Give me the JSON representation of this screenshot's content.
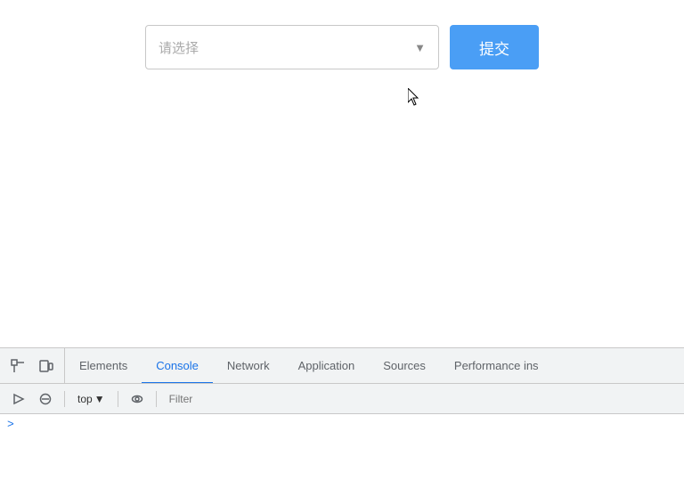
{
  "main": {
    "select_placeholder": "请选择",
    "submit_label": "提交"
  },
  "devtools": {
    "tabs": [
      {
        "id": "elements",
        "label": "Elements",
        "active": false
      },
      {
        "id": "console",
        "label": "Console",
        "active": true
      },
      {
        "id": "network",
        "label": "Network",
        "active": false
      },
      {
        "id": "application",
        "label": "Application",
        "active": false
      },
      {
        "id": "sources",
        "label": "Sources",
        "active": false
      },
      {
        "id": "performance",
        "label": "Performance ins",
        "active": false
      }
    ],
    "secondary": {
      "context_selector": "top",
      "filter_placeholder": "Filter"
    }
  },
  "icons": {
    "inspect": "⬚",
    "device": "⊡",
    "execute": "▶",
    "clear": "⊘",
    "eye": "◉",
    "chevron_down": "▾",
    "console_prompt": ">"
  }
}
